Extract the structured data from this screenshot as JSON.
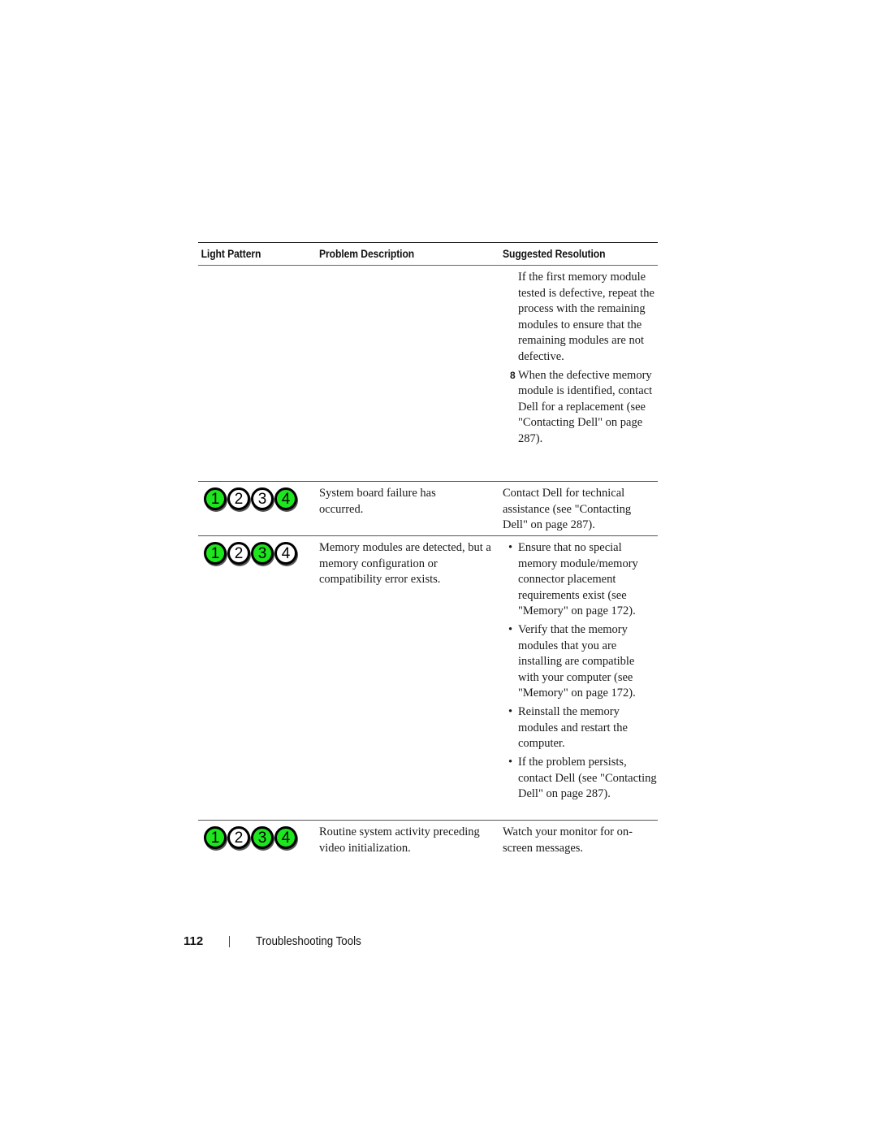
{
  "table": {
    "headers": [
      "Light Pattern",
      "Problem Description",
      "Suggested Resolution"
    ],
    "continuation_row": {
      "resolution_items": [
        {
          "marker": "",
          "text": "If the first memory module tested is defective, repeat the process with the remaining modules to ensure that the remaining modules are not defective."
        },
        {
          "marker": "8",
          "text": "When the defective memory module is identified, contact Dell for a replacement (see \"Contacting Dell\" on page 287)."
        }
      ]
    },
    "rows": [
      {
        "lights": [
          {
            "label": "1",
            "state": "on"
          },
          {
            "label": "2",
            "state": "off"
          },
          {
            "label": "3",
            "state": "off"
          },
          {
            "label": "4",
            "state": "on"
          }
        ],
        "problem": "System board failure has occurred.",
        "resolution": "Contact Dell for technical assistance (see \"Contacting Dell\" on page 287)."
      },
      {
        "lights": [
          {
            "label": "1",
            "state": "on"
          },
          {
            "label": "2",
            "state": "off"
          },
          {
            "label": "3",
            "state": "on"
          },
          {
            "label": "4",
            "state": "off"
          }
        ],
        "problem": "Memory modules are detected, but a memory configuration or compatibility error exists.",
        "resolution_items": [
          {
            "marker": "•",
            "text": "Ensure that no special memory module/memory connector placement requirements exist (see \"Memory\" on page 172)."
          },
          {
            "marker": "•",
            "text": "Verify that the memory modules that you are installing are compatible with your computer (see \"Memory\" on page 172)."
          },
          {
            "marker": "•",
            "text": "Reinstall the memory modules and restart the computer."
          },
          {
            "marker": "•",
            "text": "If the problem persists, contact Dell (see \"Contacting Dell\" on page 287)."
          }
        ]
      },
      {
        "lights": [
          {
            "label": "1",
            "state": "on"
          },
          {
            "label": "2",
            "state": "off"
          },
          {
            "label": "3",
            "state": "on"
          },
          {
            "label": "4",
            "state": "on"
          }
        ],
        "problem": "Routine system activity preceding video initialization.",
        "resolution": "Watch your monitor for on-screen messages."
      }
    ]
  },
  "colors": {
    "light_on": "#1ee61e",
    "light_off": "#ffffff"
  },
  "footer": {
    "page_number": "112",
    "separator": "|",
    "section_title": "Troubleshooting Tools"
  }
}
